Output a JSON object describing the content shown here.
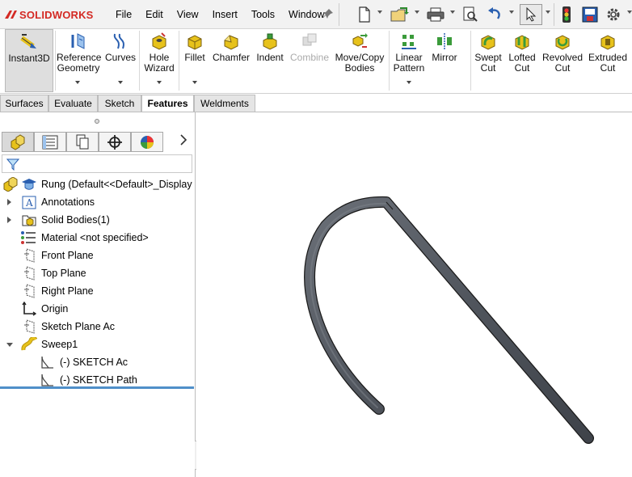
{
  "app": {
    "brand_prefix": "3DS",
    "brand": "SOLIDWORKS"
  },
  "menu": {
    "items": [
      "File",
      "Edit",
      "View",
      "Insert",
      "Tools",
      "Window"
    ]
  },
  "quick_access": {
    "icons": [
      "new-document-icon",
      "open-icon",
      "print-icon",
      "zoom-icon",
      "undo-icon",
      "select-icon",
      "traffic-light-icon",
      "options-icon",
      "gear-icon"
    ]
  },
  "ribbon": {
    "instant3d": "Instant3D",
    "reference_geometry": [
      "Reference",
      "Geometry"
    ],
    "curves": "Curves",
    "hole_wizard": [
      "Hole",
      "Wizard"
    ],
    "fillet": "Fillet",
    "chamfer": "Chamfer",
    "indent": "Indent",
    "combine": "Combine",
    "move_copy": [
      "Move/Copy",
      "Bodies"
    ],
    "linear_pattern": [
      "Linear",
      "Pattern"
    ],
    "mirror": "Mirror",
    "swept_cut": [
      "Swept",
      "Cut"
    ],
    "lofted_cut": [
      "Lofted",
      "Cut"
    ],
    "revolved_cut": [
      "Revolved",
      "Cut"
    ],
    "extruded_cut": [
      "Extruded",
      "Cut"
    ]
  },
  "tabs": [
    "Surfaces",
    "Evaluate",
    "Sketch",
    "Features",
    "Weldments"
  ],
  "active_tab": "Features",
  "tree": {
    "root": "Rung  (Default<<Default>_Display S",
    "annotations": "Annotations",
    "solid_bodies": "Solid Bodies(1)",
    "material": "Material <not specified>",
    "front_plane": "Front Plane",
    "top_plane": "Top Plane",
    "right_plane": "Right Plane",
    "origin": "Origin",
    "sketch_plane": "Sketch Plane Ac",
    "sweep": "Sweep1",
    "sketch_ac": "(-) SKETCH Ac",
    "sketch_path": "(-) SKETCH Path"
  },
  "colors": {
    "brand": "#d42a24",
    "rollback_bar": "#4f8fc9",
    "part": "#555a62",
    "feature_yellow": "#e7c21b"
  }
}
